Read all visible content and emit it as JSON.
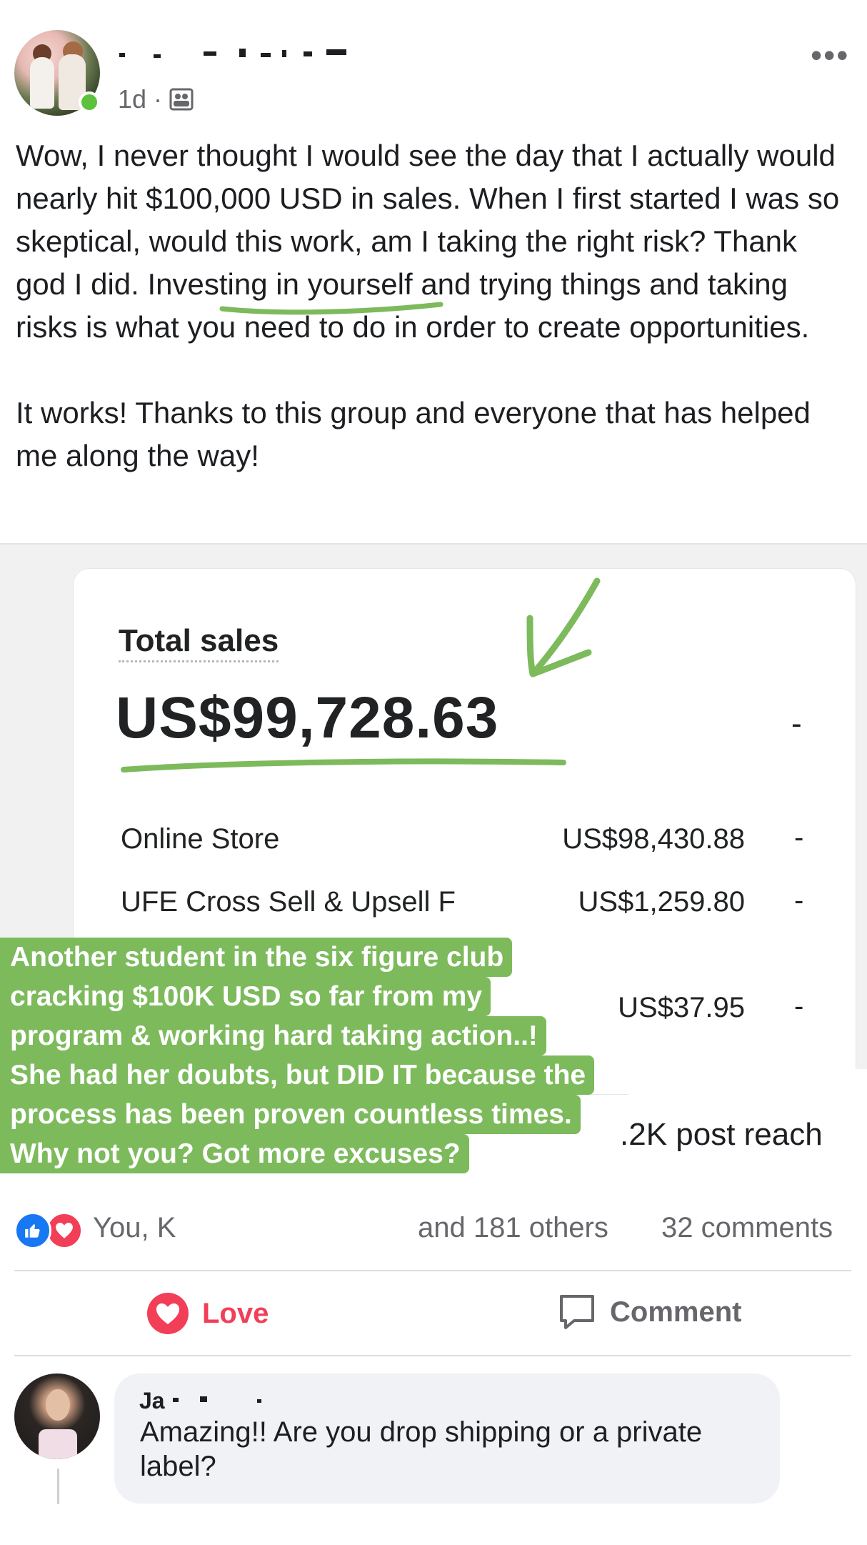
{
  "post": {
    "time": "1d",
    "separator": "·",
    "more": "•••",
    "text": "Wow, I never thought I would see the day that I actually would nearly hit $100,000 USD in sales. When I first started I was so skeptical, would this work, am I taking the right risk? Thank god I did. Investing in yourself and trying things and taking risks is what you need to do in order to create opportunities.\n\nIt works! Thanks to this group and everyone that has helped me along the way!"
  },
  "sales_card": {
    "title": "Total sales",
    "total": "US$99,728.63",
    "total_dash": "-",
    "rows": [
      {
        "label": "Online Store",
        "value": "US$98,430.88",
        "dash": "-"
      },
      {
        "label": "UFE Cross Sell & Upsell F",
        "value": "US$1,259.80",
        "dash": "-"
      },
      {
        "label": "",
        "value": "US$37.95",
        "dash": "-"
      }
    ]
  },
  "caption": {
    "lines": [
      "Another student in the six figure club",
      "cracking $100K USD so far from my",
      "program & working hard taking action..!",
      "She had her doubts, but DID IT because the",
      "process has been proven countless times.",
      "Why not you? Got more excuses?"
    ]
  },
  "reach": ".2K post reach",
  "reactions": {
    "names": "You, K",
    "others": "and 181 others",
    "comments": "32 comments"
  },
  "actions": {
    "love": "Love",
    "comment": "Comment"
  },
  "comment": {
    "name_partial": "Ja",
    "text": "Amazing!! Are you drop shipping or a private label?"
  },
  "colors": {
    "highlight_green": "#7dba5c",
    "love_red": "#f33e58",
    "like_blue": "#1877f2",
    "online_green": "#5cc13b"
  }
}
